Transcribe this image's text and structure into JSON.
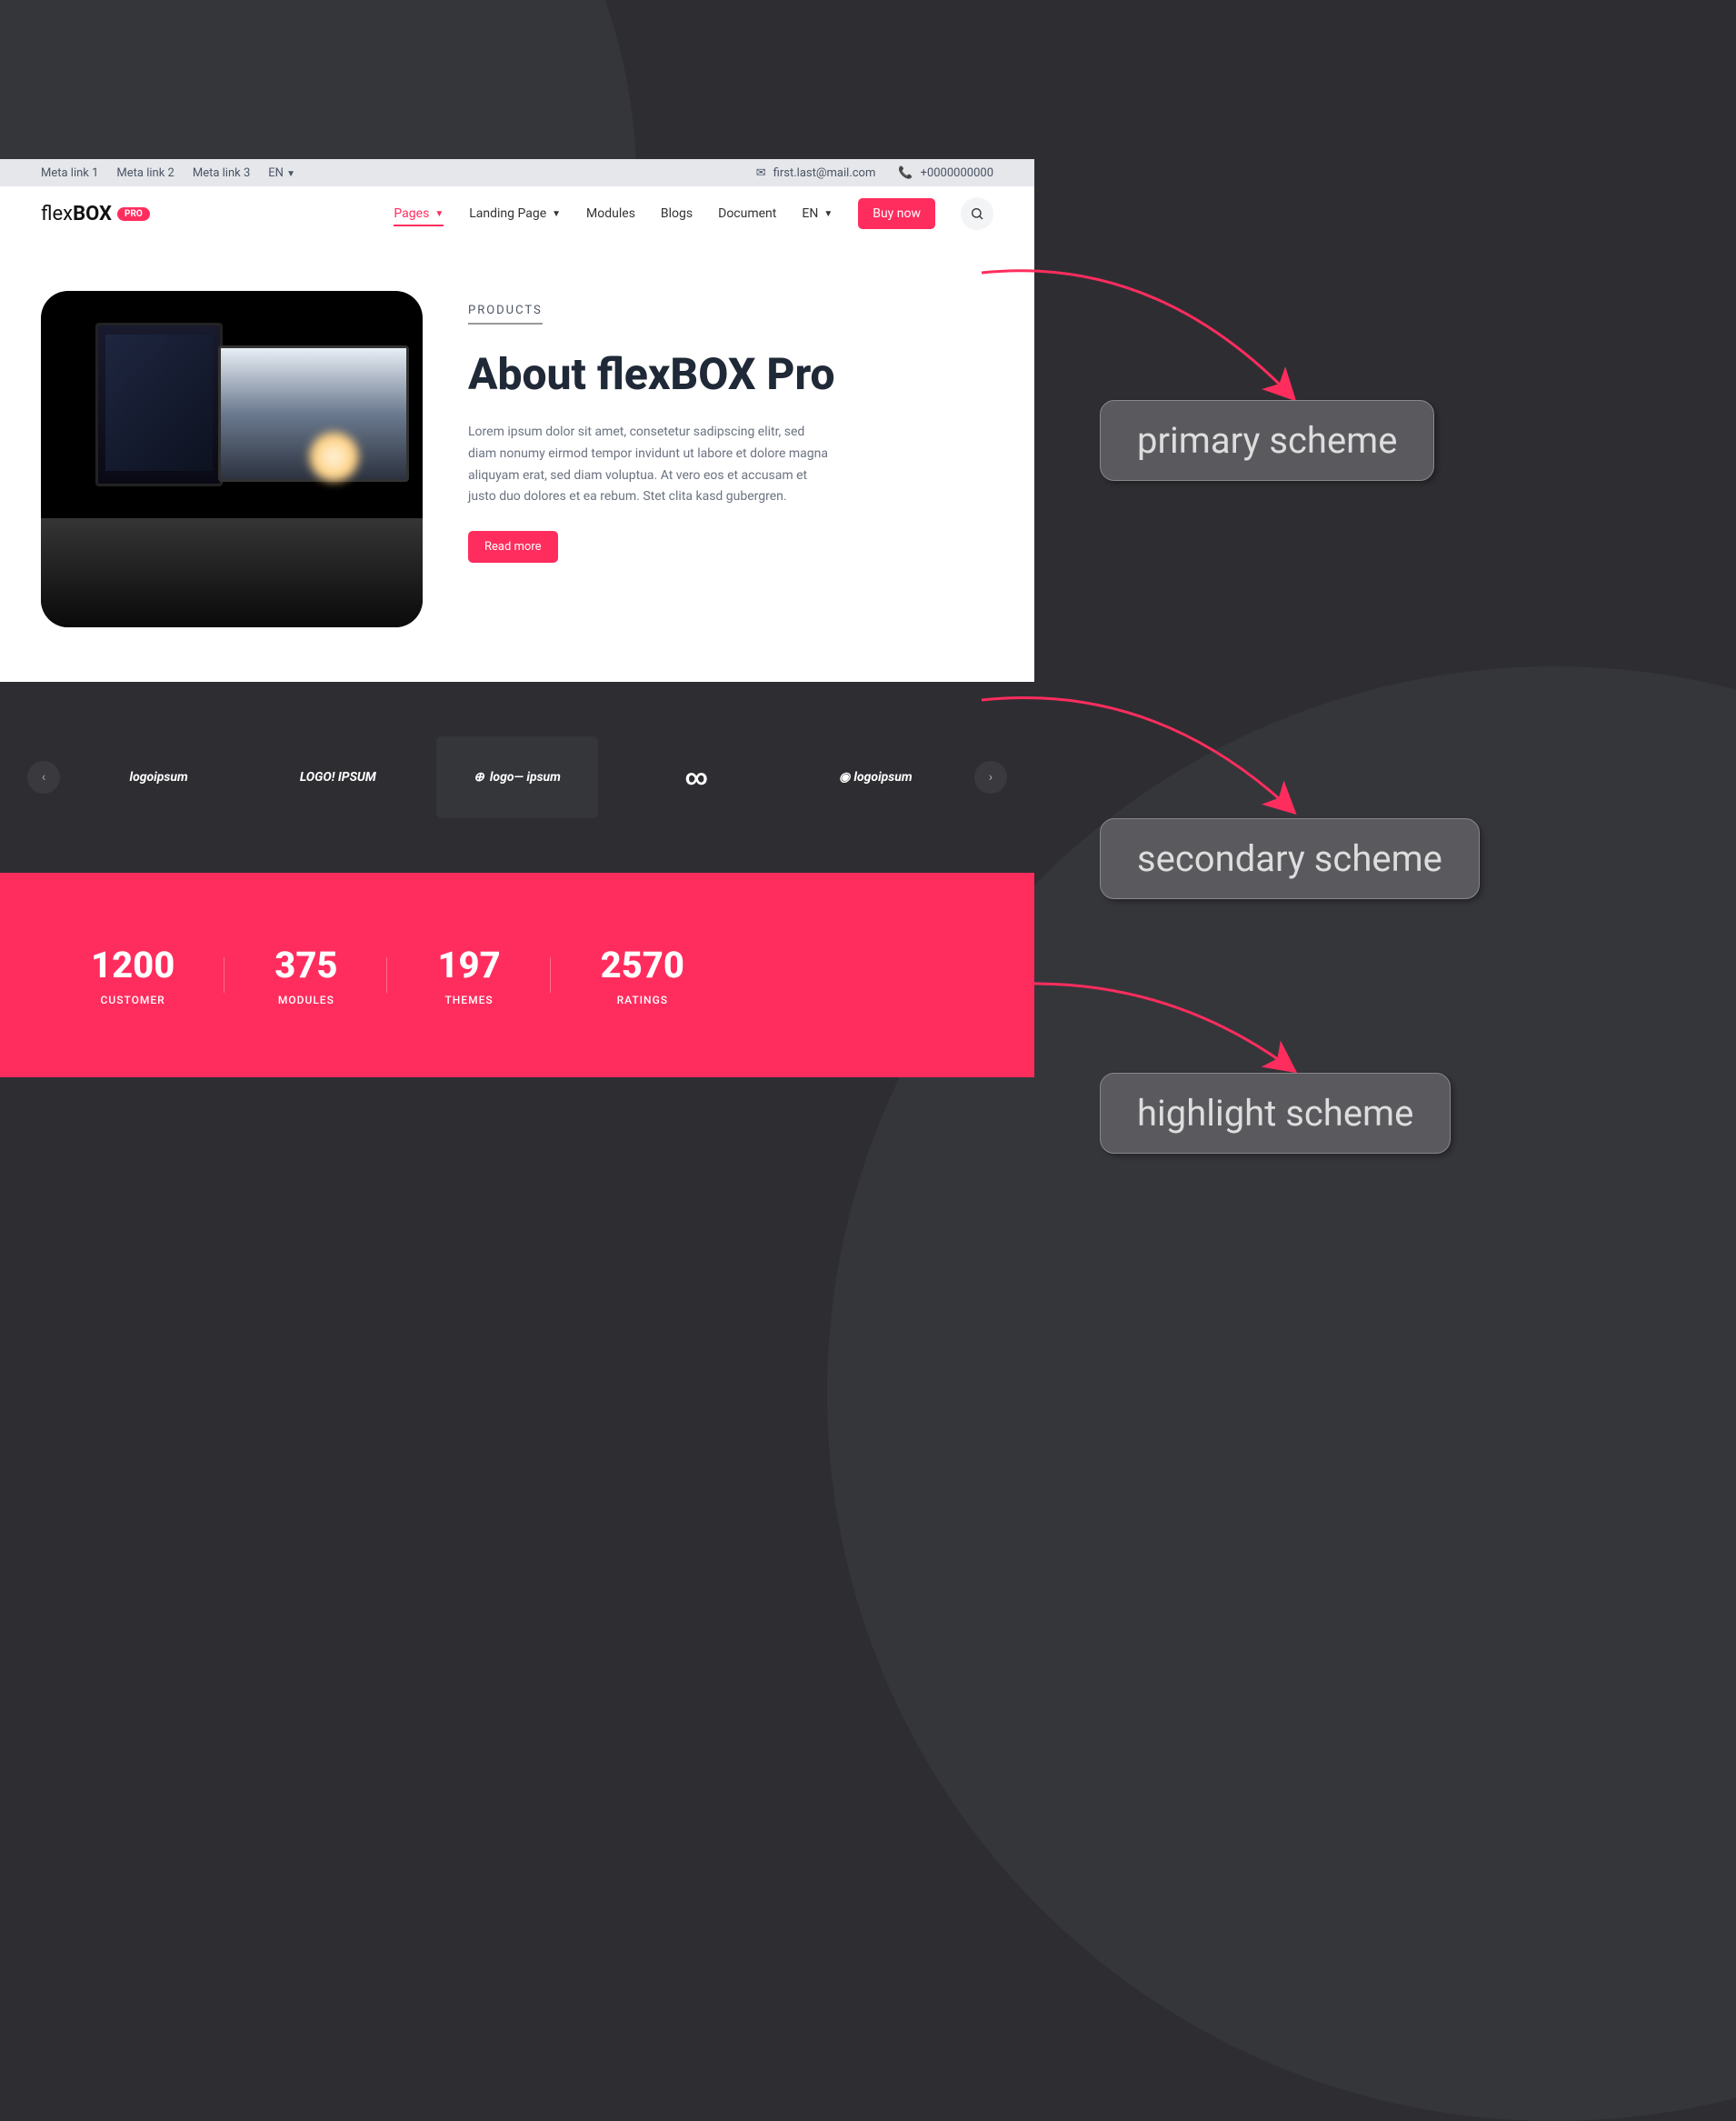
{
  "topbar": {
    "meta_links": [
      "Meta link 1",
      "Meta link 2",
      "Meta link 3"
    ],
    "lang": "EN",
    "email": "first.last@mail.com",
    "phone": "+0000000000"
  },
  "logo": {
    "text": "flexBOX",
    "badge": "PRO"
  },
  "nav": {
    "pages": "Pages",
    "landing": "Landing Page",
    "modules": "Modules",
    "blogs": "Blogs",
    "document": "Document",
    "lang": "EN",
    "buy": "Buy now"
  },
  "hero": {
    "eyebrow": "PRODUCTS",
    "title": "About flexBOX Pro",
    "text": "Lorem ipsum dolor sit amet, consetetur sadipscing elitr, sed diam nonumy eirmod tempor invidunt ut labore et dolore magna aliquyam erat, sed diam voluptua. At vero eos et accusam et justo duo dolores et ea rebum. Stet clita kasd gubergren.",
    "button": "Read more"
  },
  "logos": [
    "logoipsum",
    "LOGO! IPSUM",
    "logo— ipsum",
    "∞",
    "logoipsum"
  ],
  "stats": [
    {
      "num": "1200",
      "label": "CUSTOMER"
    },
    {
      "num": "375",
      "label": "MODULES"
    },
    {
      "num": "197",
      "label": "THEMES"
    },
    {
      "num": "2570",
      "label": "RATINGS"
    }
  ],
  "annotations": {
    "primary": "primary scheme",
    "secondary": "secondary scheme",
    "highlight": "highlight scheme"
  }
}
